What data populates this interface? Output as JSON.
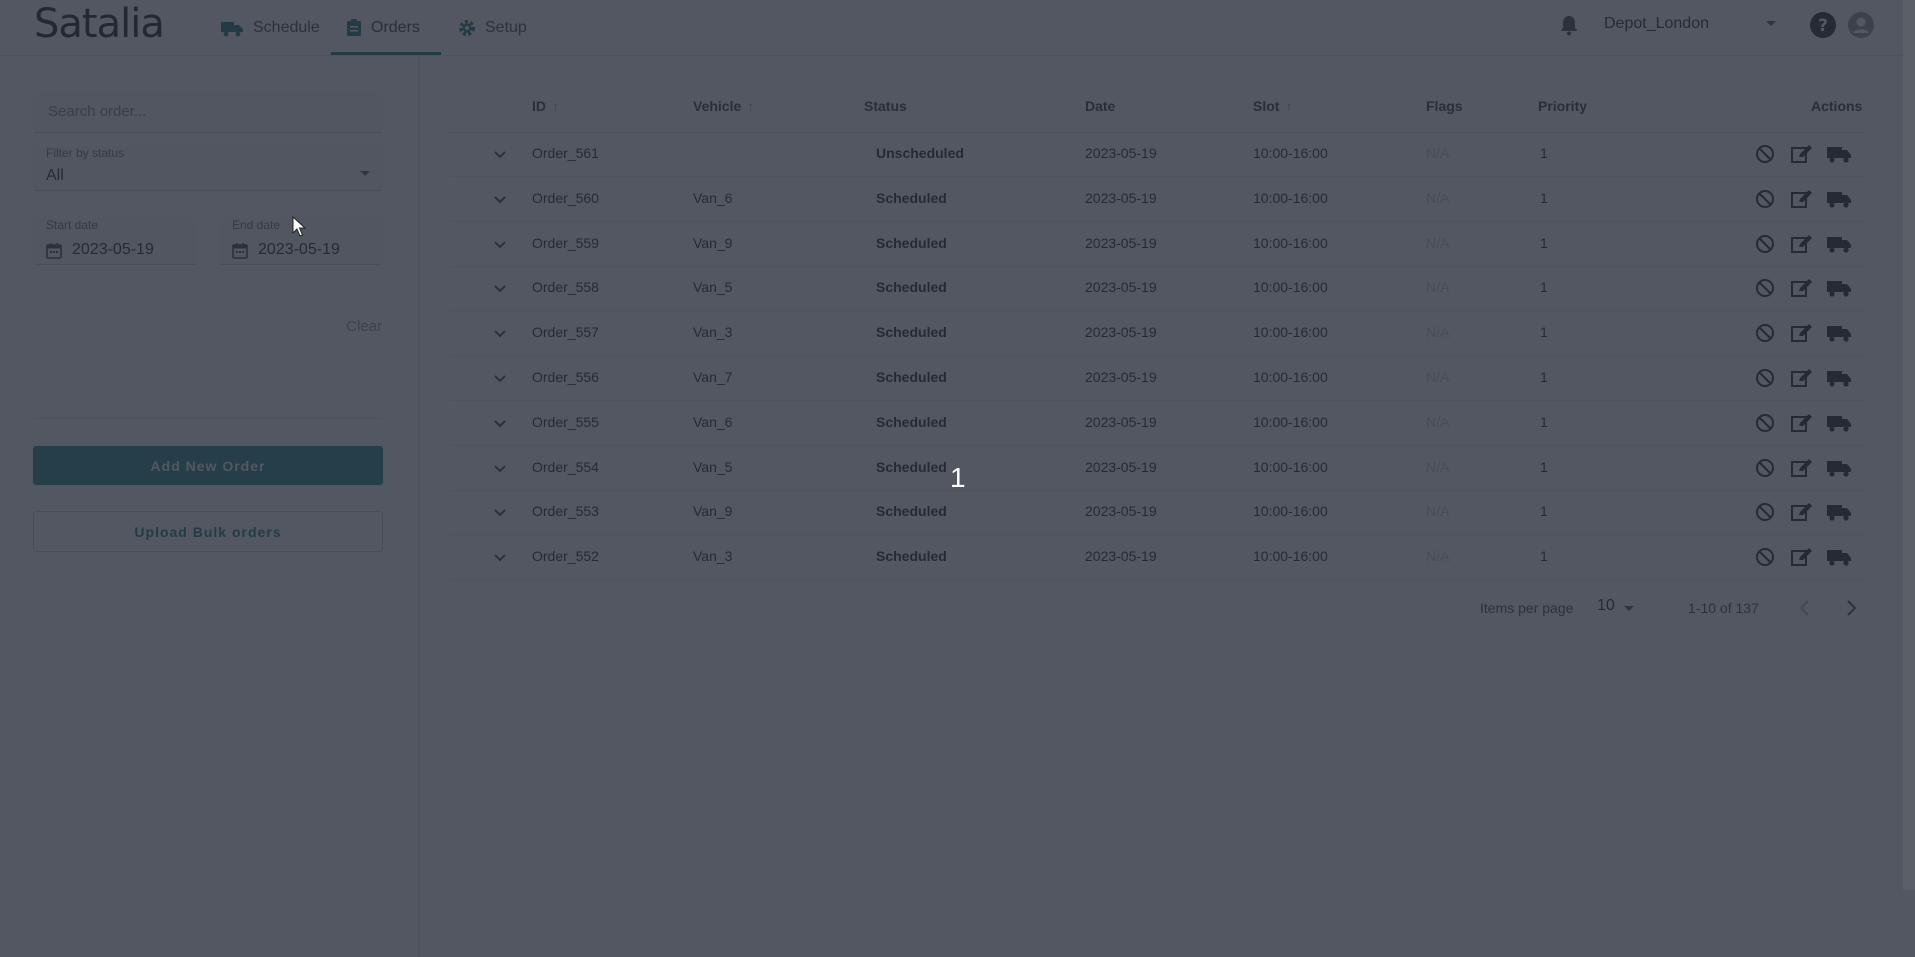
{
  "app": {
    "logo": "Satalia",
    "nav": [
      {
        "label": "Schedule",
        "icon": "truck-icon"
      },
      {
        "label": "Orders",
        "icon": "clipboard-icon",
        "active": true
      },
      {
        "label": "Setup",
        "icon": "gear-icon"
      }
    ],
    "depot": "Depot_London",
    "accent_color": "#2a7f86"
  },
  "sidebar": {
    "search_placeholder": "Search order...",
    "status_label": "Filter by status",
    "status_value": "All",
    "start_label": "Start date",
    "start_value": "2023-05-19",
    "end_label": "End date",
    "end_value": "2023-05-19",
    "clear_label": "Clear",
    "add_label": "Add New Order",
    "upload_label": "Upload Bulk orders"
  },
  "table": {
    "headers": {
      "id": "ID",
      "vehicle": "Vehicle",
      "status": "Status",
      "date": "Date",
      "slot": "Slot",
      "flags": "Flags",
      "priority": "Priority",
      "actions": "Actions"
    },
    "rows": [
      {
        "id": "Order_561",
        "vehicle": "",
        "status": "Unscheduled",
        "date": "2023-05-19",
        "slot": "10:00-16:00",
        "flags": "N/A",
        "priority": "1"
      },
      {
        "id": "Order_560",
        "vehicle": "Van_6",
        "status": "Scheduled",
        "date": "2023-05-19",
        "slot": "10:00-16:00",
        "flags": "N/A",
        "priority": "1"
      },
      {
        "id": "Order_559",
        "vehicle": "Van_9",
        "status": "Scheduled",
        "date": "2023-05-19",
        "slot": "10:00-16:00",
        "flags": "N/A",
        "priority": "1"
      },
      {
        "id": "Order_558",
        "vehicle": "Van_5",
        "status": "Scheduled",
        "date": "2023-05-19",
        "slot": "10:00-16:00",
        "flags": "N/A",
        "priority": "1"
      },
      {
        "id": "Order_557",
        "vehicle": "Van_3",
        "status": "Scheduled",
        "date": "2023-05-19",
        "slot": "10:00-16:00",
        "flags": "N/A",
        "priority": "1"
      },
      {
        "id": "Order_556",
        "vehicle": "Van_7",
        "status": "Scheduled",
        "date": "2023-05-19",
        "slot": "10:00-16:00",
        "flags": "N/A",
        "priority": "1"
      },
      {
        "id": "Order_555",
        "vehicle": "Van_6",
        "status": "Scheduled",
        "date": "2023-05-19",
        "slot": "10:00-16:00",
        "flags": "N/A",
        "priority": "1"
      },
      {
        "id": "Order_554",
        "vehicle": "Van_5",
        "status": "Scheduled",
        "date": "2023-05-19",
        "slot": "10:00-16:00",
        "flags": "N/A",
        "priority": "1"
      },
      {
        "id": "Order_553",
        "vehicle": "Van_9",
        "status": "Scheduled",
        "date": "2023-05-19",
        "slot": "10:00-16:00",
        "flags": "N/A",
        "priority": "1"
      },
      {
        "id": "Order_552",
        "vehicle": "Van_3",
        "status": "Scheduled",
        "date": "2023-05-19",
        "slot": "10:00-16:00",
        "flags": "N/A",
        "priority": "1"
      }
    ]
  },
  "pagination": {
    "items_per_page_label": "Items per page",
    "items_per_page": "10",
    "range": "1-10 of 137"
  },
  "overlay": {
    "step_number": "1"
  }
}
